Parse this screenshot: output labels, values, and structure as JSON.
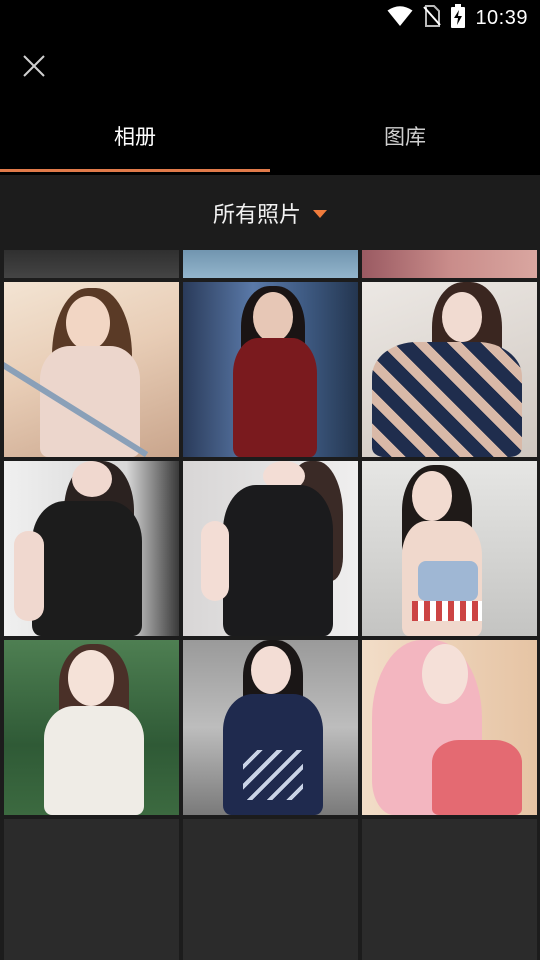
{
  "status_bar": {
    "time": "10:39",
    "icons": [
      "wifi-icon",
      "no-sim-icon",
      "battery-charging-icon"
    ]
  },
  "header": {
    "close_icon": "close-icon"
  },
  "tabs": [
    {
      "label": "相册",
      "active": true
    },
    {
      "label": "图库",
      "active": false
    }
  ],
  "filter": {
    "label": "所有照片",
    "caret_color": "#f07c3c"
  },
  "colors": {
    "accent": "#e07a4a",
    "background": "#1c1c1c",
    "header_bg": "#000000"
  },
  "photos": [
    {
      "id": "partial-1",
      "tone": "#3a3a3a"
    },
    {
      "id": "partial-2",
      "tone": "#7fa3bd"
    },
    {
      "id": "partial-3",
      "tone": "#b06b6f"
    },
    {
      "id": "fantasy-swordswoman",
      "tone": "#e9d3c0"
    },
    {
      "id": "red-dress-woman",
      "tone": "#2d3f5e"
    },
    {
      "id": "floral-kimono-woman",
      "tone": "#d8d2cc"
    },
    {
      "id": "black-halter-1",
      "tone": "#e3e3e3"
    },
    {
      "id": "black-halter-2",
      "tone": "#dedcdb"
    },
    {
      "id": "blue-bikini",
      "tone": "#d9d9d7"
    },
    {
      "id": "white-lace-dress",
      "tone": "#3e6a44"
    },
    {
      "id": "navy-lolita",
      "tone": "#a8a8a8"
    },
    {
      "id": "pink-hair",
      "tone": "#e8c8a4"
    }
  ],
  "empty_cells": 3
}
